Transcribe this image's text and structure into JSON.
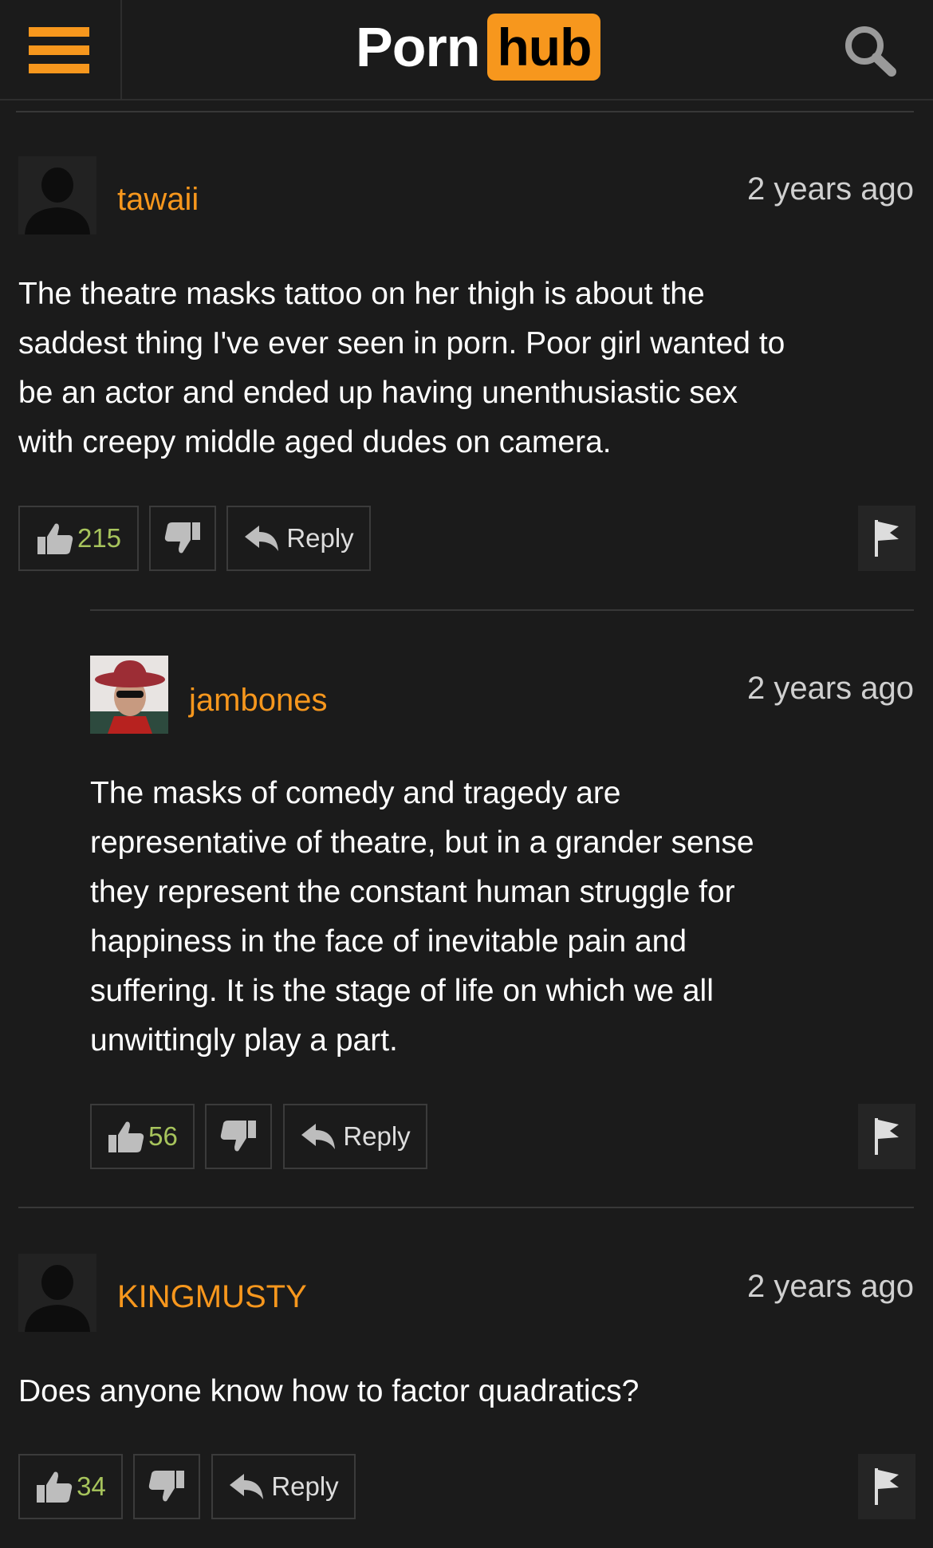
{
  "header": {
    "logo_part1": "Porn",
    "logo_part2": "hub",
    "menu_icon": "hamburger-menu-icon",
    "search_icon": "search-icon",
    "accent_color": "#f7971d"
  },
  "comments": [
    {
      "username": "tawaii",
      "time": "2 years ago",
      "text_lines": [
        "The theatre masks tattoo on her thigh is about the",
        "saddest thing I've ever seen in porn. Poor girl wanted to",
        "be an actor and ended up having unenthusiastic sex",
        "with creepy middle aged dudes on camera."
      ],
      "likes": "215",
      "reply_label": "Reply"
    },
    {
      "username": "jambones",
      "time": "2 years ago",
      "text_lines": [
        "The masks of comedy and tragedy are",
        "representative of theatre, but in a grander sense",
        "they represent the constant human struggle for",
        "happiness in the face of inevitable pain and",
        "suffering. It is the stage of life on which we all",
        "unwittingly play a part."
      ],
      "likes": "56",
      "reply_label": "Reply"
    },
    {
      "username": "KINGMUSTY",
      "time": "2 years ago",
      "text_lines": [
        "Does anyone know how to factor quadratics?"
      ],
      "likes": "34",
      "reply_label": "Reply"
    }
  ]
}
